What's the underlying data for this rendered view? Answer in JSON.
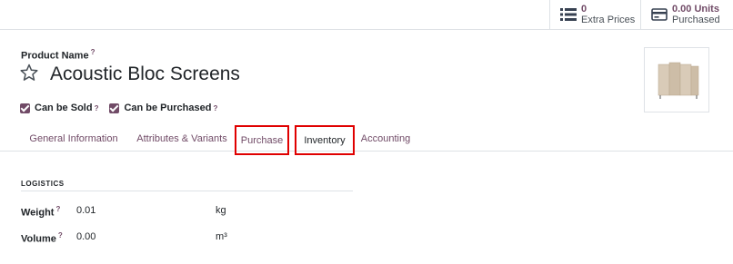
{
  "stats": {
    "extra_prices": {
      "value": "0",
      "label": "Extra Prices",
      "icon": "list-icon"
    },
    "purchased": {
      "value": "0.00 Units",
      "label": "Purchased",
      "icon": "credit-card-icon"
    }
  },
  "product": {
    "name_label": "Product Name",
    "help_mark": "?",
    "name": "Acoustic Bloc Screens",
    "can_be_sold_label": "Can be Sold",
    "can_be_purchased_label": "Can be Purchased"
  },
  "tabs": [
    {
      "label": "General Information"
    },
    {
      "label": "Attributes & Variants"
    },
    {
      "label": "Purchase"
    },
    {
      "label": "Inventory"
    },
    {
      "label": "Accounting"
    }
  ],
  "logistics": {
    "title": "LOGISTICS",
    "weight": {
      "label": "Weight",
      "value": "0.01",
      "unit": "kg"
    },
    "volume": {
      "label": "Volume",
      "value": "0.00",
      "unit": "m³"
    }
  },
  "colors": {
    "accent": "#714b67",
    "highlight": "#e00000"
  }
}
